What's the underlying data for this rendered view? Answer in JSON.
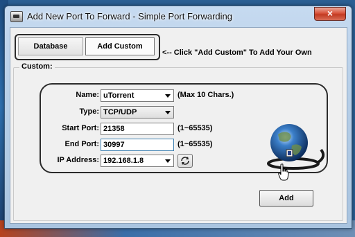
{
  "window": {
    "title": "Add New Port To Forward - Simple Port Forwarding",
    "close_glyph": "×"
  },
  "tabs": {
    "database": "Database",
    "add_custom": "Add Custom"
  },
  "hint": "<-- Click \"Add Custom\" To Add Your Own",
  "custom_group": {
    "label": "Custom:"
  },
  "form": {
    "name": {
      "label": "Name:",
      "value": "uTorrent",
      "note": "(Max 10 Chars.)"
    },
    "type": {
      "label": "Type:",
      "value": "TCP/UDP"
    },
    "start_port": {
      "label": "Start Port:",
      "value": "21358",
      "note": "(1~65535)"
    },
    "end_port": {
      "label": "End Port:",
      "value": "30997",
      "note": "(1~65535)"
    },
    "ip_address": {
      "label": "IP Address:",
      "value": "192.168.1.8"
    }
  },
  "add_button": "Add",
  "icons": {
    "app": "network-card-icon",
    "globe": "globe-network-icon",
    "refresh": "refresh-icon",
    "cursor": "hand-cursor-icon"
  }
}
